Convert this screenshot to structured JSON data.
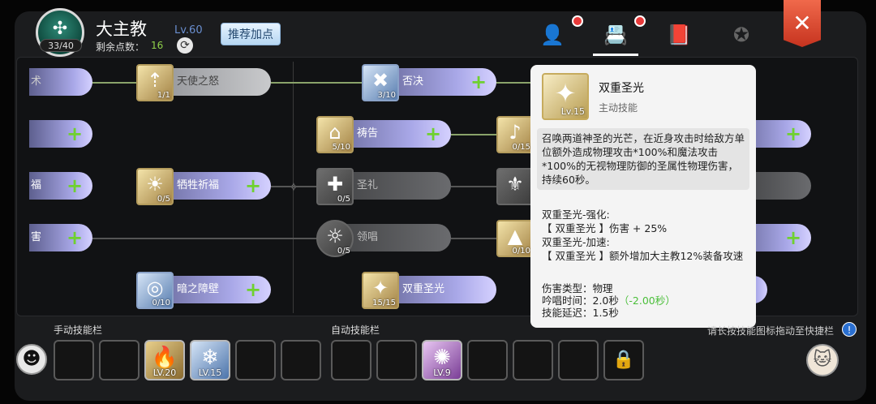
{
  "header": {
    "class_name": "大主教",
    "level": "Lv.60",
    "points_label": "剩余点数：",
    "points_value": "16",
    "avatar_count": "33/40",
    "recommend_label": "推荐加点",
    "close_label": "✕"
  },
  "tabs": [
    {
      "icon": "character-icon",
      "glyph": "👤"
    },
    {
      "icon": "skill-book-icon",
      "glyph": "📇"
    },
    {
      "icon": "book-icon",
      "glyph": "📕"
    },
    {
      "icon": "emblem-icon",
      "glyph": "✪"
    }
  ],
  "tree": {
    "left_fragments": [
      "术",
      "福",
      "害"
    ],
    "nodes": {
      "angel_wrath": {
        "name": "天使之怒",
        "count": "1/1",
        "glyph": "⇡"
      },
      "sacrifice": {
        "name": "牺牲祈福",
        "count": "0/5",
        "glyph": "☀"
      },
      "dark_barrier": {
        "name": "暗之障壁",
        "count": "0/10",
        "glyph": "◎"
      },
      "veto": {
        "name": "否决",
        "count": "3/10",
        "glyph": "✖"
      },
      "prayer": {
        "name": "祷告",
        "count": "5/10",
        "glyph": "⌂"
      },
      "holy_rite": {
        "name": "圣礼",
        "count": "0/5",
        "glyph": "✚"
      },
      "lead": {
        "name": "领唱",
        "count": "0/5",
        "glyph": "☼"
      },
      "double_holy_light": {
        "name": "双重圣光",
        "count": "15/15",
        "glyph": "✦"
      },
      "c4_row2": {
        "count": "0/15",
        "glyph": "♪"
      },
      "c4_row4": {
        "count": "0/10",
        "glyph": "▲"
      },
      "c4_row3": {
        "glyph": "⚜"
      }
    }
  },
  "tooltip": {
    "name": "双重圣光",
    "type": "主动技能",
    "level": "Lv.15",
    "description": "召唤两道神圣的光芒，在近身攻击时给敌方单位额外造成物理攻击*100%和魔法攻击*100%的无视物理防御的圣属性物理伤害，持续60秒。",
    "upgrade_lines": [
      "双重圣光-强化:",
      "【 双重圣光 】伤害 + 25%",
      "双重圣光-加速:",
      "【 双重圣光 】额外增加大主教12%装备攻速"
    ],
    "damage_type": "伤害类型：物理",
    "cast_time": "吟唱时间：2.0秒",
    "cast_bonus": "（-2.00秒）",
    "delay": "技能延迟：1.5秒"
  },
  "bars": {
    "manual_label": "手动技能栏",
    "auto_label": "自动技能栏",
    "hint": "请长按技能图标拖动至快捷栏",
    "manual_slots": [
      {
        "filled": false
      },
      {
        "filled": false
      },
      {
        "filled": true,
        "level": "LV.20",
        "glyph": "🔥",
        "style": "gold"
      },
      {
        "filled": true,
        "level": "LV.15",
        "glyph": "❄",
        "style": "blue"
      },
      {
        "filled": false
      },
      {
        "filled": false
      }
    ],
    "auto_slots": [
      {
        "filled": false
      },
      {
        "filled": false
      },
      {
        "filled": true,
        "level": "LV.9",
        "glyph": "✺",
        "style": "purple"
      },
      {
        "filled": false
      },
      {
        "filled": false
      },
      {
        "filled": false
      },
      {
        "filled": false,
        "locked": true
      }
    ]
  }
}
